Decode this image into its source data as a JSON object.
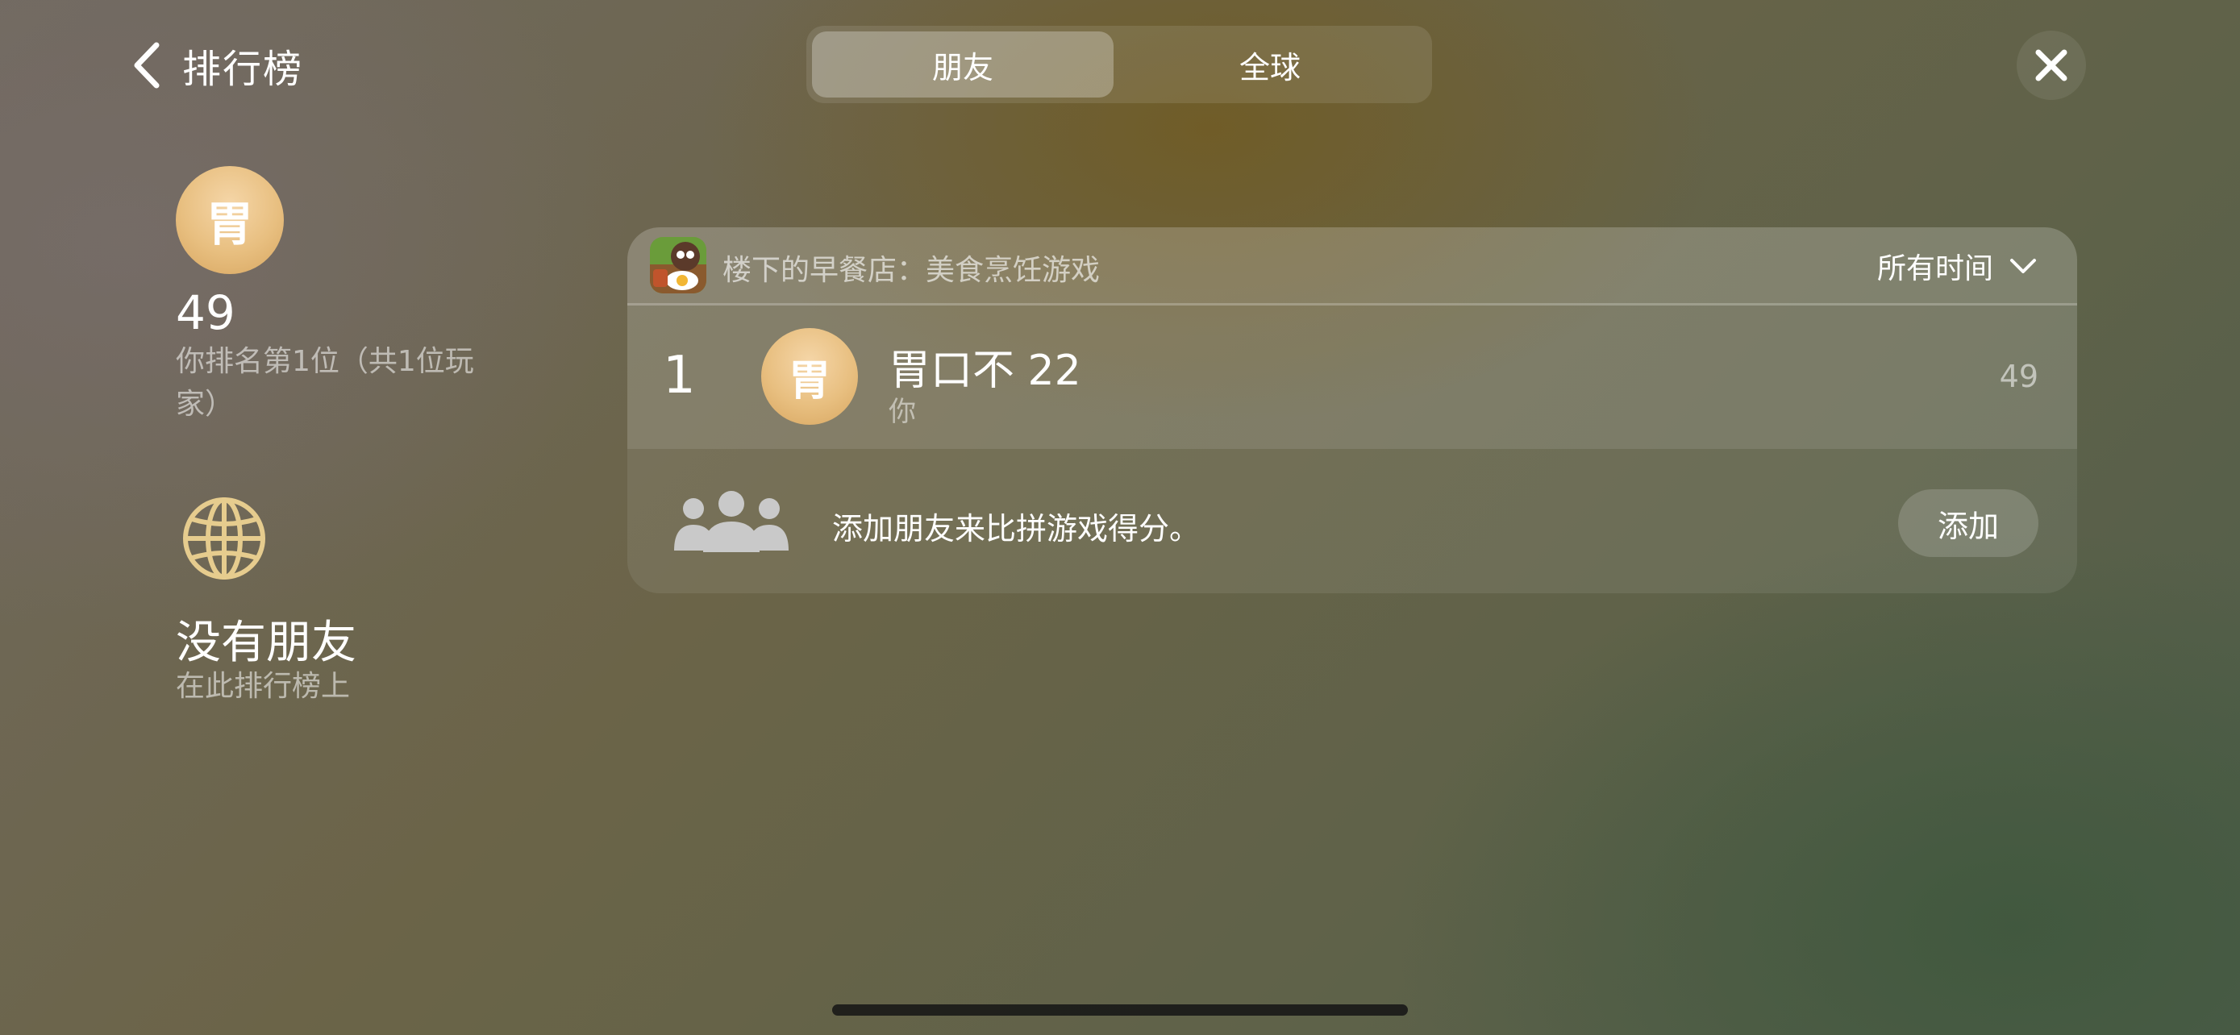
{
  "header": {
    "back_label": "排行榜",
    "tabs": [
      {
        "label": "朋友",
        "active": true
      },
      {
        "label": "全球",
        "active": false
      }
    ]
  },
  "player_summary": {
    "avatar_initial": "胃",
    "score": "49",
    "rank_text": "你排名第1位（共1位玩家）"
  },
  "global_section": {
    "icon": "globe-icon",
    "title": "没有朋友",
    "subtitle": "在此排行榜上"
  },
  "leaderboard": {
    "game_title": "楼下的早餐店：美食烹饪游戏",
    "time_filter": "所有时间",
    "entries": [
      {
        "rank": "1",
        "avatar_initial": "胃",
        "name": "胃口不 22",
        "subtitle": "你",
        "score": "49"
      }
    ],
    "add_friends": {
      "text": "添加朋友来比拼游戏得分。",
      "button_label": "添加"
    }
  },
  "colors": {
    "avatar_gold": "#e8bf80",
    "globe_gold": "#e6cc8e"
  }
}
